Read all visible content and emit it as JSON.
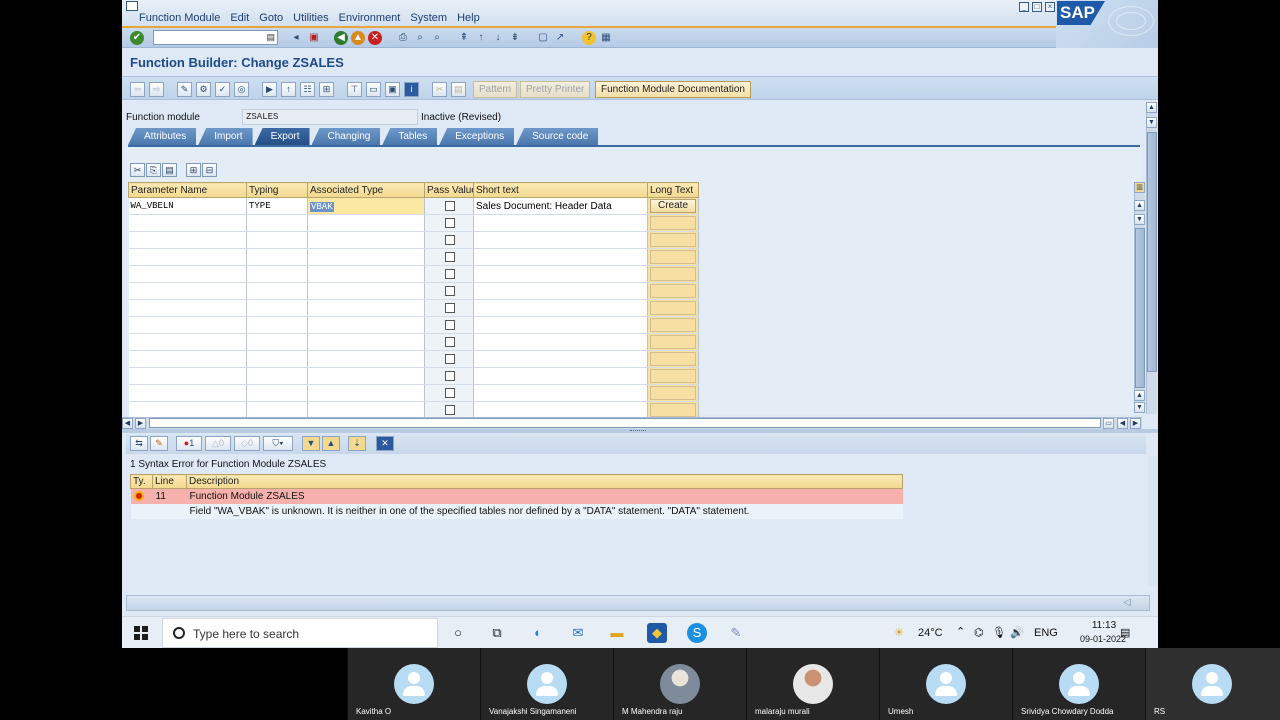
{
  "menu": [
    "Function Module",
    "Edit",
    "Goto",
    "Utilities",
    "Environment",
    "System",
    "Help"
  ],
  "sap_logo": "SAP",
  "title": "Function Builder: Change ZSALES",
  "app_toolbar": {
    "pattern": "Pattern",
    "pretty_printer": "Pretty Printer",
    "fm_documentation": "Function Module Documentation"
  },
  "header": {
    "function_module_label": "Function module",
    "function_module_value": "ZSALES",
    "status": "Inactive (Revised)"
  },
  "tabs": [
    {
      "label": "Attributes",
      "active": false
    },
    {
      "label": "Import",
      "active": false
    },
    {
      "label": "Export",
      "active": true
    },
    {
      "label": "Changing",
      "active": false
    },
    {
      "label": "Tables",
      "active": false
    },
    {
      "label": "Exceptions",
      "active": false
    },
    {
      "label": "Source code",
      "active": false
    }
  ],
  "params_table": {
    "columns": [
      "Parameter Name",
      "Typing",
      "Associated Type",
      "Pass Value",
      "Short text",
      "Long Text"
    ],
    "row": {
      "parameter_name": "WA_VBELN",
      "typing": "TYPE",
      "associated_type": "VBAK",
      "short_text": "Sales Document: Header Data",
      "long_text": "Create"
    }
  },
  "error_toolbar": {
    "errors_count": "1",
    "warnings_count": "0",
    "info_count": "0"
  },
  "error_list": {
    "heading": "1 Syntax Error for Function Module ZSALES",
    "columns": [
      "Ty.",
      "Line",
      "Description"
    ],
    "line": "11",
    "title_row": "Function Module ZSALES",
    "message": "Field \"WA_VBAK\" is unknown. It is neither in one of the specified tables nor defined by a \"DATA\" statement. \"DATA\" statement."
  },
  "taskbar": {
    "search_placeholder": "Type here to search",
    "weather": "24°C",
    "language": "ENG",
    "time": "11:13",
    "date": "09-01-2022"
  },
  "participants": [
    "Kavitha O",
    "Vanajakshi Singamaneni",
    "M Mahendra raju",
    "malaraju murali",
    "Umesh",
    "Srividya Chowdary Dodda",
    "RS"
  ],
  "colors": {
    "sap_title": "#1b4b8a",
    "tab_active": "#254e86",
    "grid_header": "#f2d98e",
    "error_row": "#f6b1ad",
    "menu_underline": "#e7a53c"
  }
}
